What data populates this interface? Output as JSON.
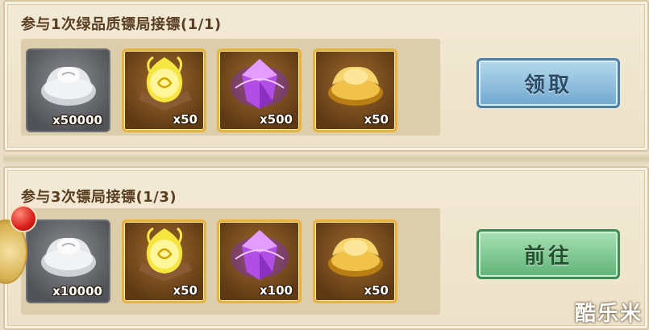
{
  "tasks": [
    {
      "title": "参与1次绿品质镖局接镖(1/1)",
      "button_label": "领取",
      "items": [
        {
          "icon": "silver-ingot-icon",
          "count": "x50000"
        },
        {
          "icon": "gold-flame-orb-icon",
          "count": "x50"
        },
        {
          "icon": "purple-crystal-icon",
          "count": "x500"
        },
        {
          "icon": "gold-ingot-icon",
          "count": "x50"
        }
      ]
    },
    {
      "title": "参与3次镖局接镖(1/3)",
      "button_label": "前往",
      "items": [
        {
          "icon": "silver-ingot-icon",
          "count": "x10000"
        },
        {
          "icon": "gold-flame-orb-icon",
          "count": "x50"
        },
        {
          "icon": "purple-crystal-icon",
          "count": "x100"
        },
        {
          "icon": "gold-ingot-icon",
          "count": "x50"
        }
      ]
    }
  ],
  "watermark": "酷乐米",
  "colors": {
    "claim_button": "#6fa8cf",
    "go_button": "#5fb377",
    "gold_frame": "#e8b23c",
    "notification_dot": "#d8201a"
  }
}
